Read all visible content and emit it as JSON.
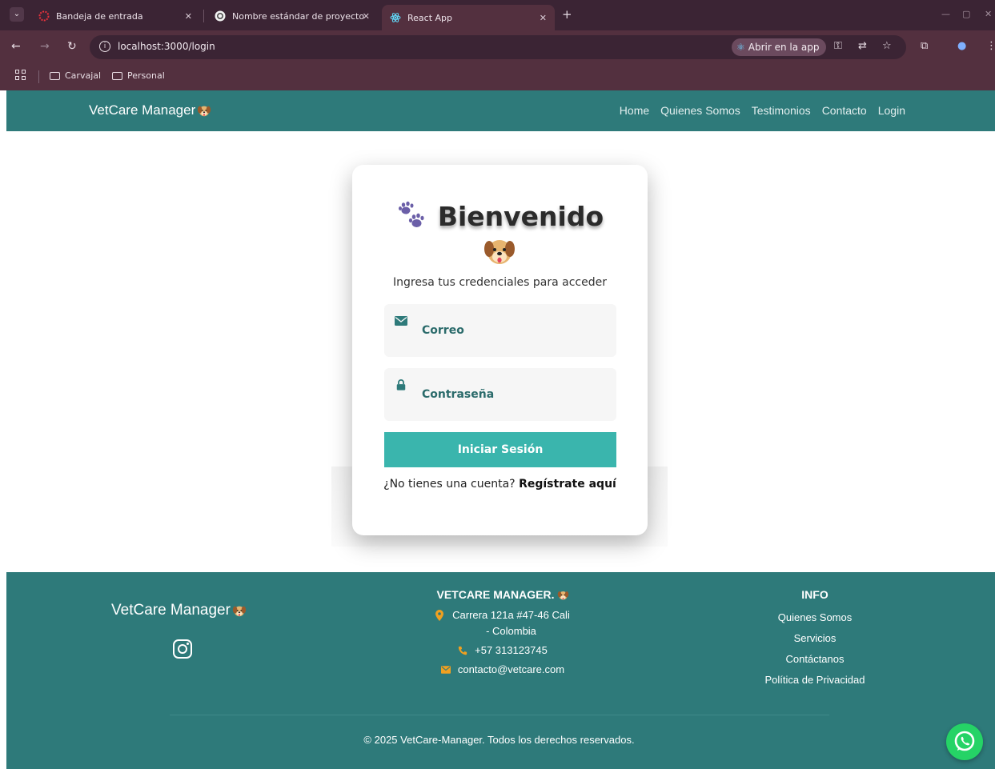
{
  "browser": {
    "tabs": [
      {
        "title": "Bandeja de entrada",
        "active": false
      },
      {
        "title": "Nombre estándar de proyecto",
        "active": false
      },
      {
        "title": "React App",
        "active": true
      }
    ],
    "url": "localhost:3000/login",
    "open_in_app_label": "Abrir en la app",
    "bookmarks": [
      "Carvajal",
      "Personal"
    ]
  },
  "navbar": {
    "brand": "VetCare Manager",
    "links": [
      "Home",
      "Quienes Somos",
      "Testimonios",
      "Contacto",
      "Login"
    ]
  },
  "login": {
    "title": "Bienvenido",
    "subtitle": "Ingresa tus credenciales para acceder",
    "email_label": "Correo",
    "password_label": "Contraseña",
    "submit_label": "Iniciar Sesión",
    "footer_prompt": "¿No tienes una cuenta?",
    "register_link": "Regístrate aquí"
  },
  "footer": {
    "brand": "VetCare Manager",
    "company_heading": "VETCARE MANAGER.",
    "address": "Carrera 121a #47-46 Cali - Colombia",
    "phone": "+57 313123745",
    "email": "contacto@vetcare.com",
    "info_heading": "INFO",
    "info_links": [
      "Quienes Somos",
      "Servicios",
      "Contáctanos",
      "Política de Privacidad"
    ],
    "copyright": "© 2025 VetCare-Manager. Todos los derechos reservados."
  },
  "colors": {
    "brand_teal": "#2e7a7a",
    "button_teal": "#3ab5ad",
    "label_teal": "#2b6b6b",
    "icon_orange": "#f0a020",
    "whatsapp_green": "#25d366",
    "browser_frame": "#53303f"
  },
  "icons": {
    "title": "paw-prints-icon",
    "email": "envelope-icon",
    "password": "lock-icon",
    "social": "instagram-icon",
    "chat": "whatsapp-icon"
  }
}
